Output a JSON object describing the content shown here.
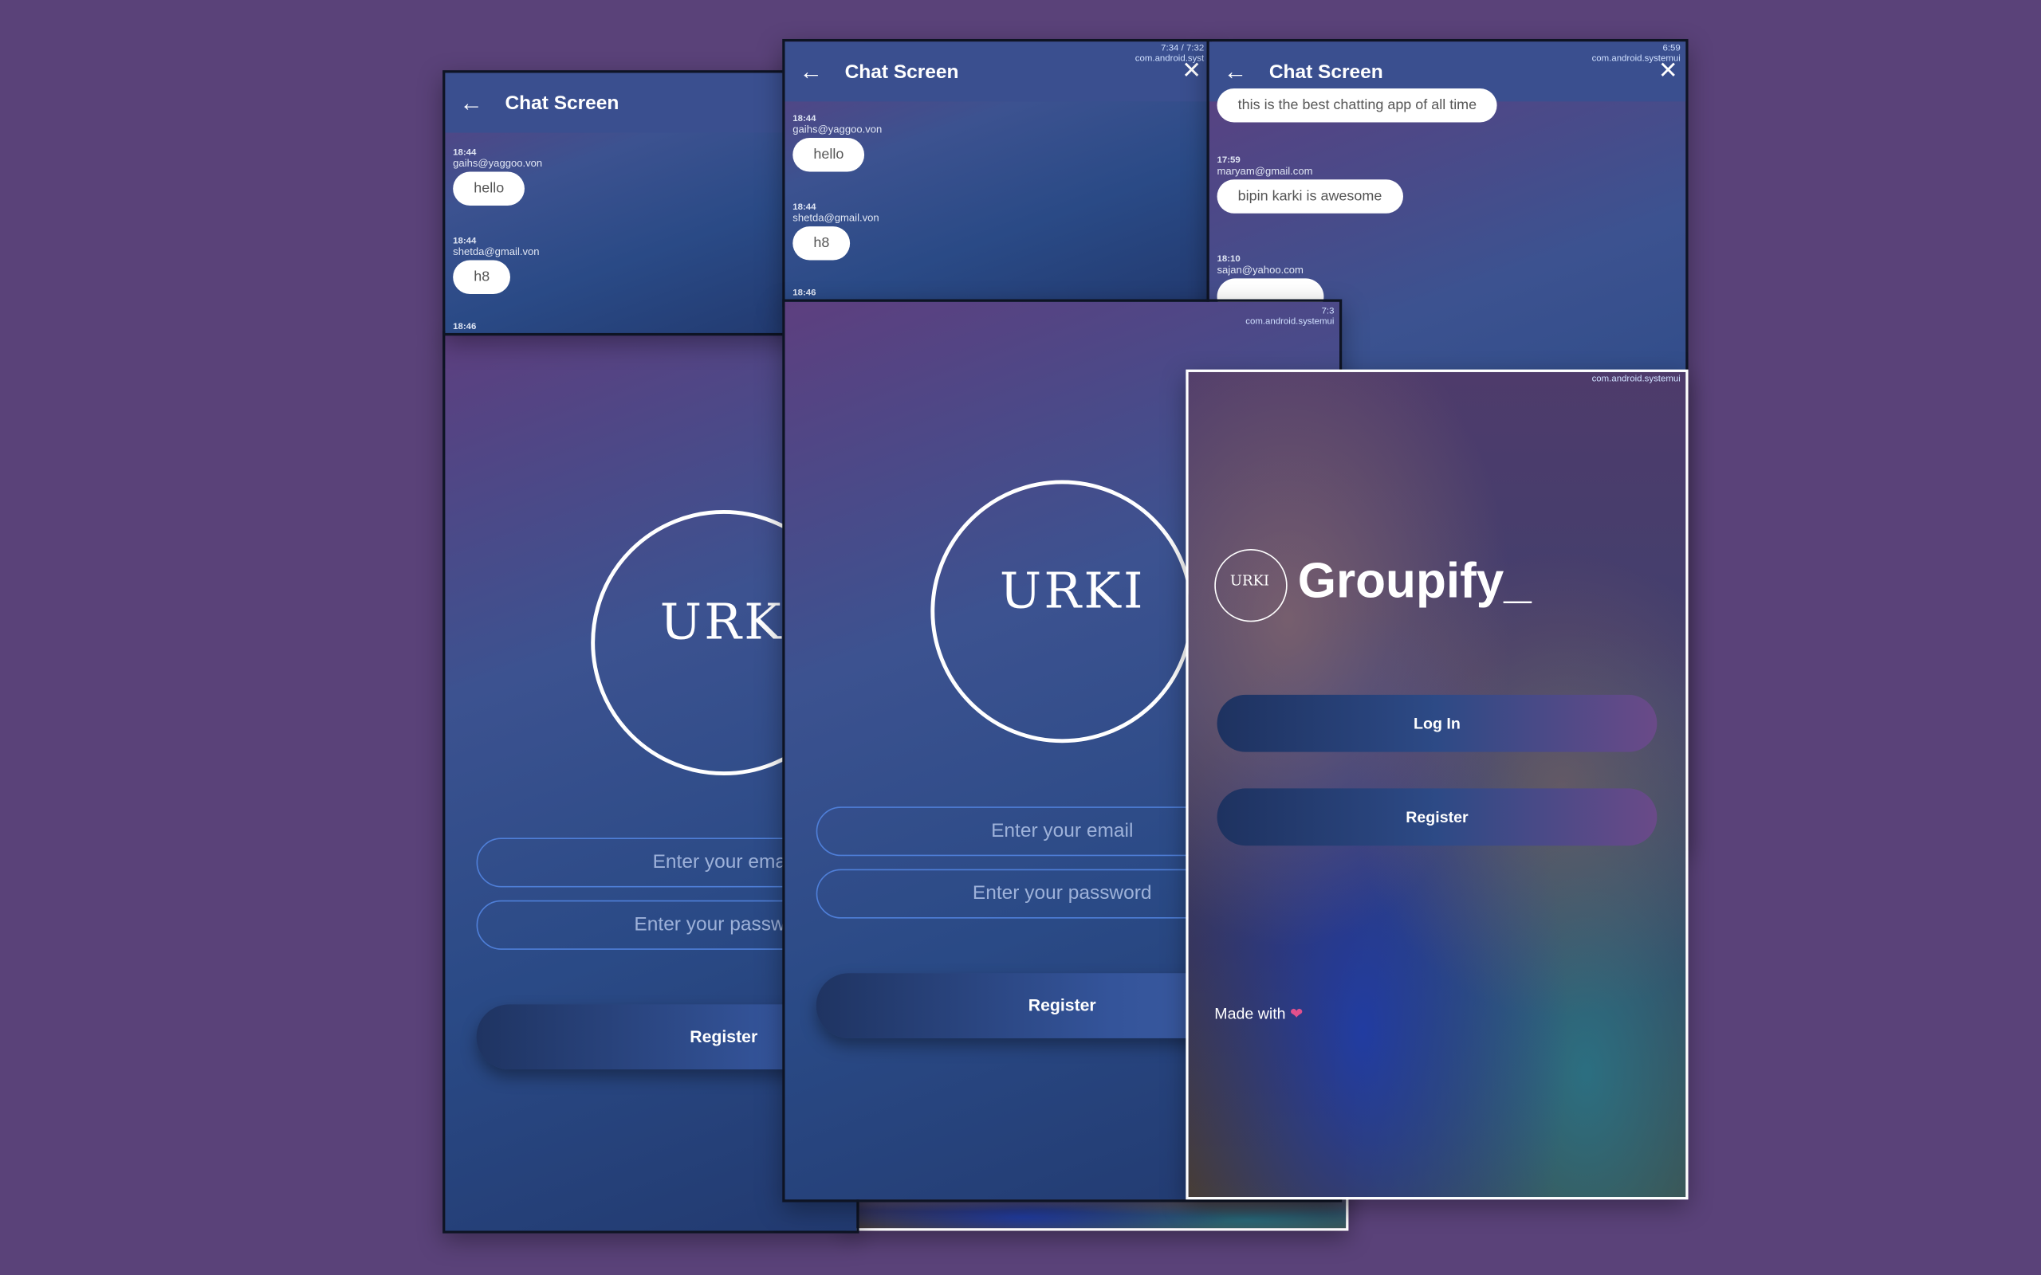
{
  "chat_title": "Chat Screen",
  "chat_a": {
    "status": "",
    "messages": [
      {
        "time": "18:44",
        "sender": "gaihs@yaggoo.von",
        "text": "hello"
      },
      {
        "time": "18:44",
        "sender": "shetda@gmail.von",
        "text": "h8"
      },
      {
        "time": "18:46",
        "sender": "",
        "text": ""
      }
    ]
  },
  "chat_b": {
    "status_line1": "7:34 / 7:32",
    "status_line2": "com.android.syst",
    "messages": [
      {
        "time": "18:44",
        "sender": "gaihs@yaggoo.von",
        "text": "hello"
      },
      {
        "time": "18:44",
        "sender": "shetda@gmail.von",
        "text": "h8"
      },
      {
        "time": "18:46",
        "sender": "",
        "text": ""
      }
    ]
  },
  "chat_c": {
    "status_line1": "6:59",
    "status_line2": "com.android.systemui",
    "messages": [
      {
        "time": "",
        "sender": "",
        "text": "this is the best chatting app of all time"
      },
      {
        "time": "17:59",
        "sender": "maryam@gmail.com",
        "text": "bipin karki is awesome"
      },
      {
        "time": "18:10",
        "sender": "sajan@yahoo.com",
        "text": ""
      }
    ]
  },
  "register_a": {
    "logo": "URKI",
    "email_placeholder": "Enter your email",
    "password_placeholder": "Enter your password",
    "register_label": "Register"
  },
  "register_b": {
    "status_line1": "7:3",
    "status_line2": "com.android.systemui",
    "logo": "URKI",
    "email_placeholder": "Enter your email",
    "password_placeholder": "Enter your password",
    "register_label": "Register"
  },
  "groupify": {
    "status_line2": "com.android.systemui",
    "logo_small": "URKI",
    "brand": "Groupify_",
    "login_label": "Log In",
    "register_label": "Register",
    "made_with": "Made with",
    "heart": "❤"
  },
  "colors": {
    "background": "#5a4279",
    "appbar": "#3a4f8f",
    "field_border": "#4f7fd8",
    "heart": "#e2508c"
  }
}
